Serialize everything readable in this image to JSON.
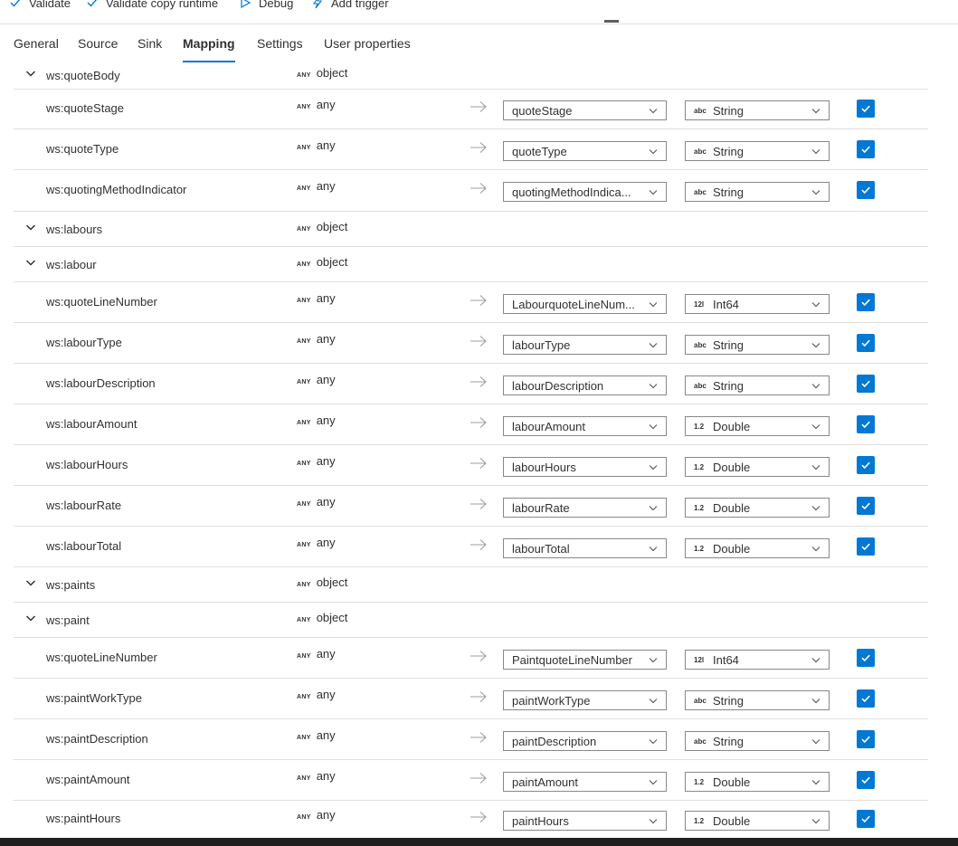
{
  "toolbar": {
    "validate": "Validate",
    "validate_copy_runtime": "Validate copy runtime",
    "debug": "Debug",
    "add_trigger": "Add trigger"
  },
  "tabs": [
    "General",
    "Source",
    "Sink",
    "Mapping",
    "Settings",
    "User properties"
  ],
  "active_tab": "Mapping",
  "any_tag": "ANY",
  "rows": [
    {
      "kind": "group",
      "name": "ws:quoteBody",
      "type": "object"
    },
    {
      "kind": "field",
      "name": "ws:quoteStage",
      "type": "any",
      "column": "quoteStage",
      "dest_glyph": "abc",
      "dest_type": "String",
      "checked": true
    },
    {
      "kind": "field",
      "name": "ws:quoteType",
      "type": "any",
      "column": "quoteType",
      "dest_glyph": "abc",
      "dest_type": "String",
      "checked": true
    },
    {
      "kind": "field",
      "name": "ws:quotingMethodIndicator",
      "type": "any",
      "column": "quotingMethodIndica...",
      "dest_glyph": "abc",
      "dest_type": "String",
      "checked": true
    },
    {
      "kind": "group",
      "name": "ws:labours",
      "type": "object"
    },
    {
      "kind": "group",
      "name": "ws:labour",
      "type": "object"
    },
    {
      "kind": "field",
      "name": "ws:quoteLineNumber",
      "type": "any",
      "column": "LabourquoteLineNum...",
      "dest_glyph": "12l",
      "dest_type": "Int64",
      "checked": true
    },
    {
      "kind": "field",
      "name": "ws:labourType",
      "type": "any",
      "column": "labourType",
      "dest_glyph": "abc",
      "dest_type": "String",
      "checked": true
    },
    {
      "kind": "field",
      "name": "ws:labourDescription",
      "type": "any",
      "column": "labourDescription",
      "dest_glyph": "abc",
      "dest_type": "String",
      "checked": true
    },
    {
      "kind": "field",
      "name": "ws:labourAmount",
      "type": "any",
      "column": "labourAmount",
      "dest_glyph": "1.2",
      "dest_type": "Double",
      "checked": true
    },
    {
      "kind": "field",
      "name": "ws:labourHours",
      "type": "any",
      "column": "labourHours",
      "dest_glyph": "1.2",
      "dest_type": "Double",
      "checked": true
    },
    {
      "kind": "field",
      "name": "ws:labourRate",
      "type": "any",
      "column": "labourRate",
      "dest_glyph": "1.2",
      "dest_type": "Double",
      "checked": true
    },
    {
      "kind": "field",
      "name": "ws:labourTotal",
      "type": "any",
      "column": "labourTotal",
      "dest_glyph": "1.2",
      "dest_type": "Double",
      "checked": true
    },
    {
      "kind": "group",
      "name": "ws:paints",
      "type": "object"
    },
    {
      "kind": "group",
      "name": "ws:paint",
      "type": "object"
    },
    {
      "kind": "field",
      "name": "ws:quoteLineNumber",
      "type": "any",
      "column": "PaintquoteLineNumber",
      "dest_glyph": "12l",
      "dest_type": "Int64",
      "checked": true
    },
    {
      "kind": "field",
      "name": "ws:paintWorkType",
      "type": "any",
      "column": "paintWorkType",
      "dest_glyph": "abc",
      "dest_type": "String",
      "checked": true
    },
    {
      "kind": "field",
      "name": "ws:paintDescription",
      "type": "any",
      "column": "paintDescription",
      "dest_glyph": "abc",
      "dest_type": "String",
      "checked": true
    },
    {
      "kind": "field",
      "name": "ws:paintAmount",
      "type": "any",
      "column": "paintAmount",
      "dest_glyph": "1.2",
      "dest_type": "Double",
      "checked": true
    },
    {
      "kind": "field",
      "name": "ws:paintHours",
      "type": "any",
      "column": "paintHours",
      "dest_glyph": "1.2",
      "dest_type": "Double",
      "checked": true
    }
  ],
  "colors": {
    "accent": "#0078d4",
    "text": "#323130",
    "border": "#8a8886",
    "divider": "#e1dfdd"
  }
}
